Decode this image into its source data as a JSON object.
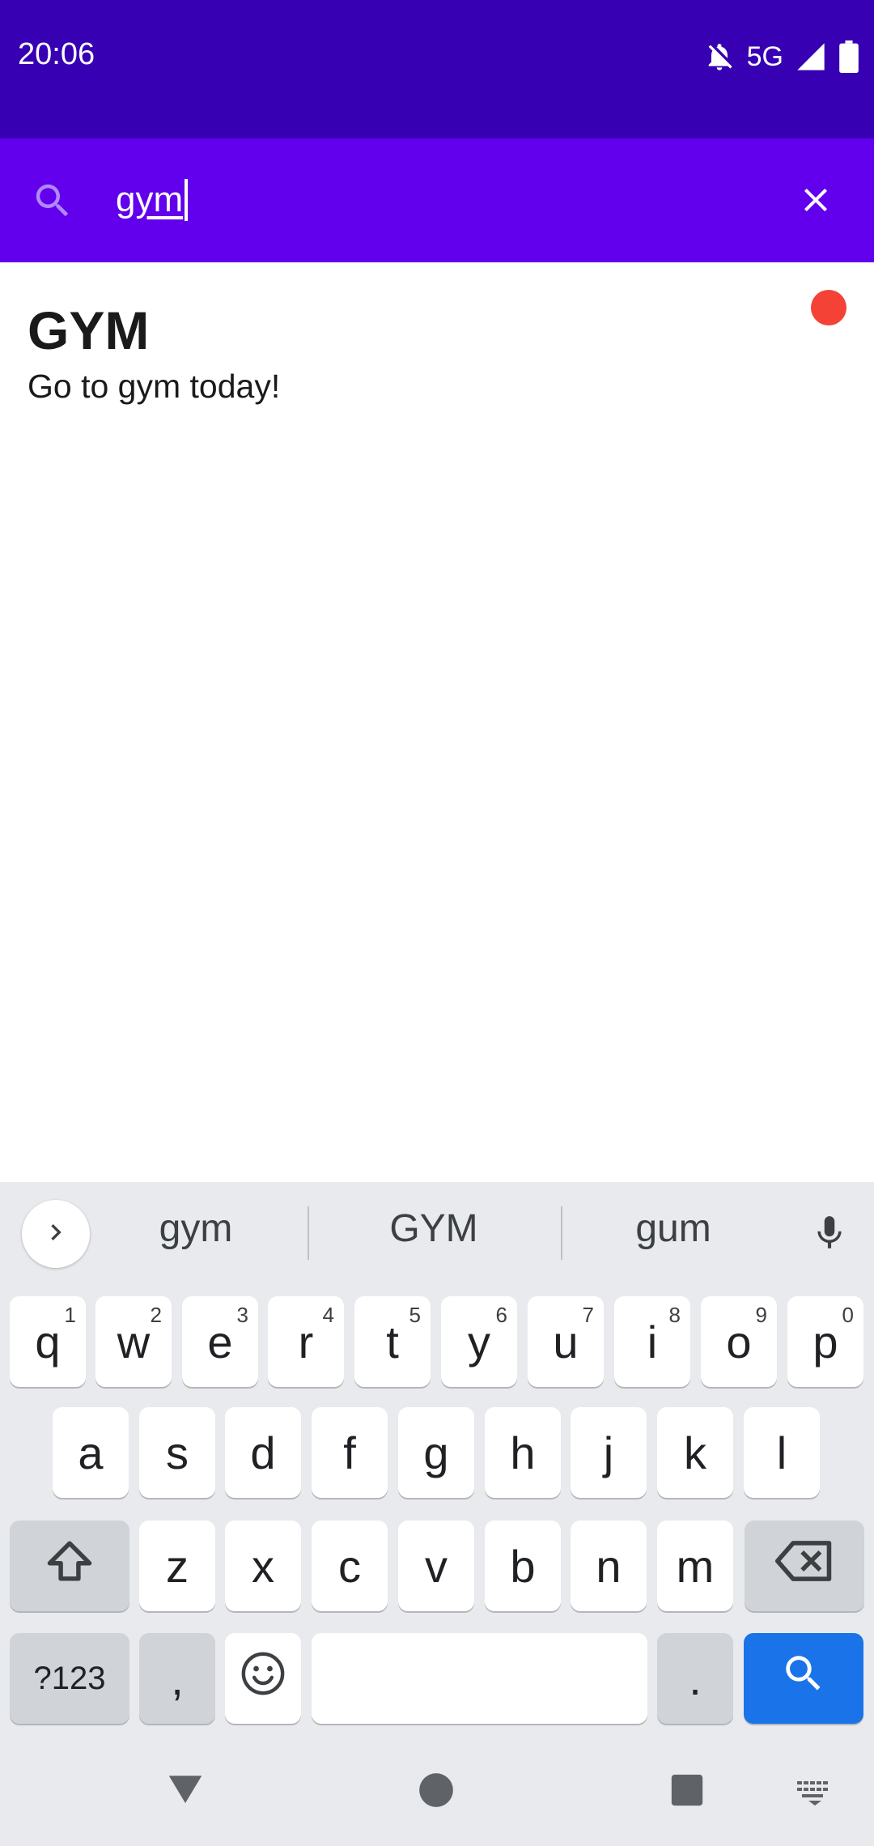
{
  "status_bar": {
    "time": "20:06",
    "network": "5G",
    "icons": [
      "bell-off-icon",
      "signal-icon",
      "battery-icon"
    ],
    "background": "#3700b3"
  },
  "search": {
    "query": "gym",
    "icon": "search-icon",
    "clear_icon": "close-icon",
    "background": "#6200ee"
  },
  "results": [
    {
      "title": "GYM",
      "body": "Go to gym today!",
      "dot_color": "#f44336"
    }
  ],
  "keyboard": {
    "suggestions": [
      "gym",
      "GYM",
      "gum"
    ],
    "row1": [
      {
        "label": "q",
        "hint": "1"
      },
      {
        "label": "w",
        "hint": "2"
      },
      {
        "label": "e",
        "hint": "3"
      },
      {
        "label": "r",
        "hint": "4"
      },
      {
        "label": "t",
        "hint": "5"
      },
      {
        "label": "y",
        "hint": "6"
      },
      {
        "label": "u",
        "hint": "7"
      },
      {
        "label": "i",
        "hint": "8"
      },
      {
        "label": "o",
        "hint": "9"
      },
      {
        "label": "p",
        "hint": "0"
      }
    ],
    "row2": [
      "a",
      "s",
      "d",
      "f",
      "g",
      "h",
      "j",
      "k",
      "l"
    ],
    "row3": [
      "z",
      "x",
      "c",
      "v",
      "b",
      "n",
      "m"
    ],
    "symbols_label": "?123",
    "comma_label": ",",
    "period_label": ".",
    "accent_color": "#1a73e8"
  },
  "nav_bar": {
    "icons": [
      "back-icon",
      "home-icon",
      "recents-icon",
      "keyboard-switch-icon"
    ]
  }
}
